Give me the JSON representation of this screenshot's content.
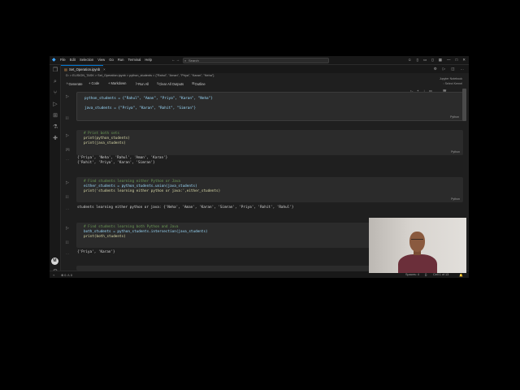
{
  "menu": [
    "File",
    "Edit",
    "Selection",
    "View",
    "Go",
    "Run",
    "Terminal",
    "Help"
  ],
  "search": {
    "placeholder": "Search"
  },
  "tab": {
    "label": "Set_Operation.ipynb"
  },
  "breadcrumb": "D: > ELISION_TASK > Set_Operation.ipynb > python_students = {\"Rahul\", \"Aman\", \"Priya\", \"Karan\", \"Neha\"}",
  "toolbar": {
    "generate": "Generate",
    "code": "+ Code",
    "markdown": "+ Markdown",
    "run_all": "Run All",
    "clear_outputs": "Clear All Outputs",
    "outline": "Outline"
  },
  "kernel": {
    "type": "Jupyter Notebook",
    "select": "Select Kernel"
  },
  "cells": [
    {
      "exec": "[ ]",
      "lang": "Python",
      "lines": [
        "python_students = {\"Rahul\", \"Aman\", \"Priya\", \"Karan\", \"Neha\"}",
        "",
        "java_students = {\"Priya\", \"Karan\", \"Rohit\", \"Simran\"}"
      ]
    },
    {
      "exec": "[3]",
      "lang": "Python",
      "lines": [
        "# Print both sets",
        "print(python_students)",
        "print(java_students)"
      ],
      "output": [
        "{'Priya', 'Neha', 'Rahul', 'Aman', 'Karan'}",
        "{'Rohit', 'Priya', 'Karan', 'Simran'}"
      ]
    },
    {
      "exec": "[ ]",
      "lang": "Python",
      "lines": [
        "# Find students learning either Python or Java",
        "either_students = python_students.union(java_students)",
        "print('students learning either python or java:',either_students)"
      ],
      "output": [
        "students learning either python or java: {'Neha', 'Aman', 'Karan', 'Simran', 'Priya', 'Rohit', 'Rahul'}"
      ]
    },
    {
      "exec": "[ ]",
      "lang": "Python",
      "lines": [
        "# Find students learning both Python and Java",
        "both_students = python_students.intersection(java_students)",
        "print(both_students)"
      ],
      "output": [
        "{'Priya', 'Karan'}"
      ]
    }
  ],
  "status": {
    "errors": "⊗ 0 ⚠ 0",
    "spaces": "Spaces: 4",
    "cell": "Cell 1 of 13"
  },
  "colors": {
    "background": "#1f1f1f",
    "accent": "#0078d4"
  }
}
